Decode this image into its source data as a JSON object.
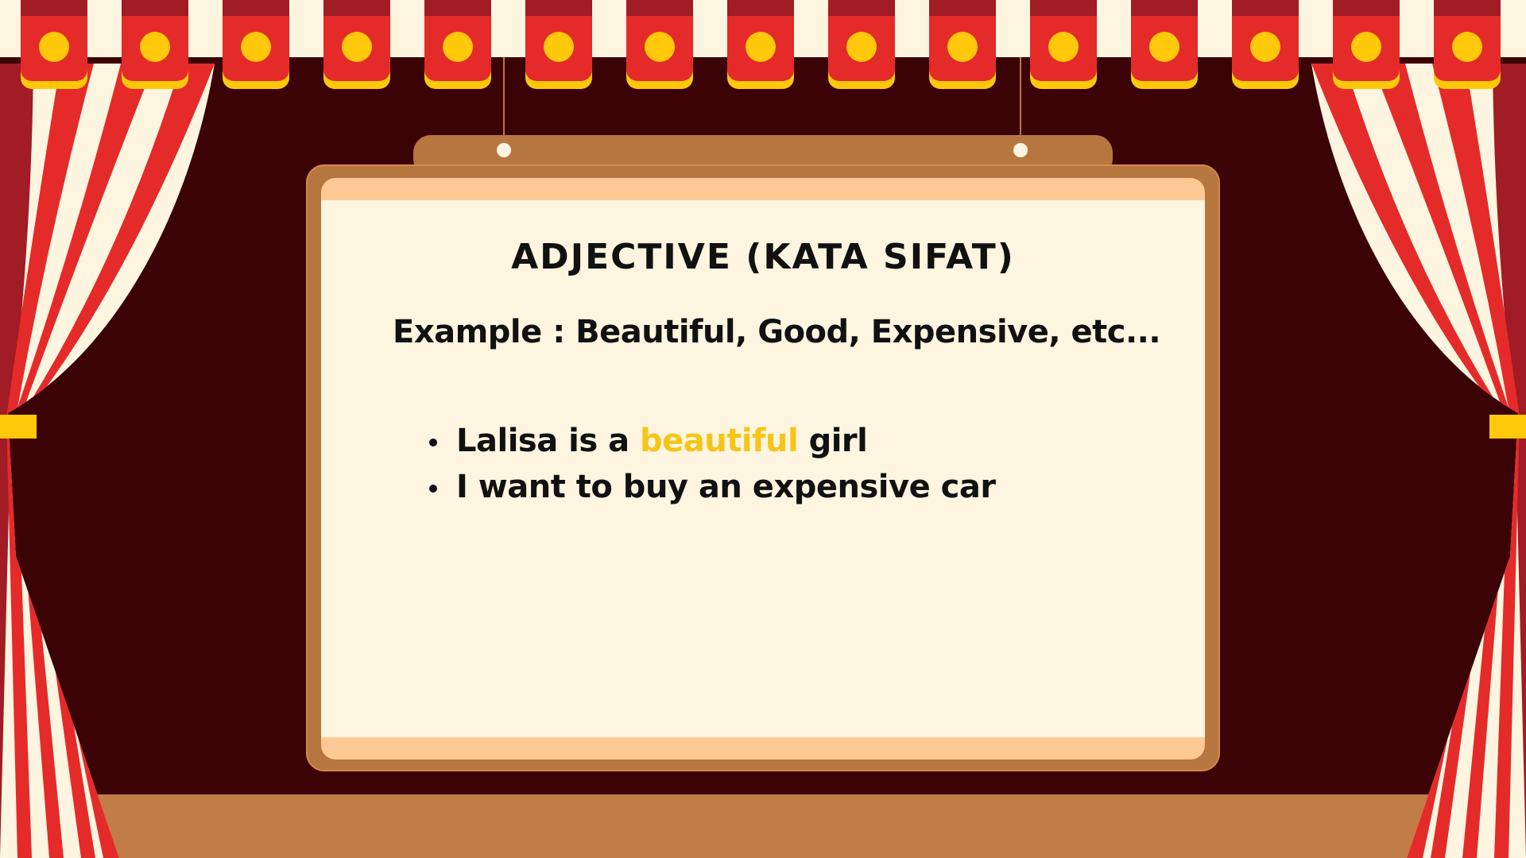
{
  "slide": {
    "title": "ADJECTIVE (KATA SIFAT)",
    "example": "Example : Beautiful, Good, Expensive, etc...",
    "bullets": [
      {
        "before": "Lalisa is a ",
        "highlight": "beautiful",
        "after": " girl"
      },
      {
        "before": "I want to buy an expensive car",
        "highlight": "",
        "after": ""
      }
    ]
  },
  "colors": {
    "backdrop": "#3b0306",
    "curtain_red": "#e52a2a",
    "curtain_cream": "#fdf5e0",
    "valance_gold": "#ffc80a",
    "board_frame": "#b5773f",
    "board_surface": "#fdf5e0",
    "board_band": "#ffc995",
    "stage_floor": "#c27c47",
    "highlight": "#f7c518"
  }
}
